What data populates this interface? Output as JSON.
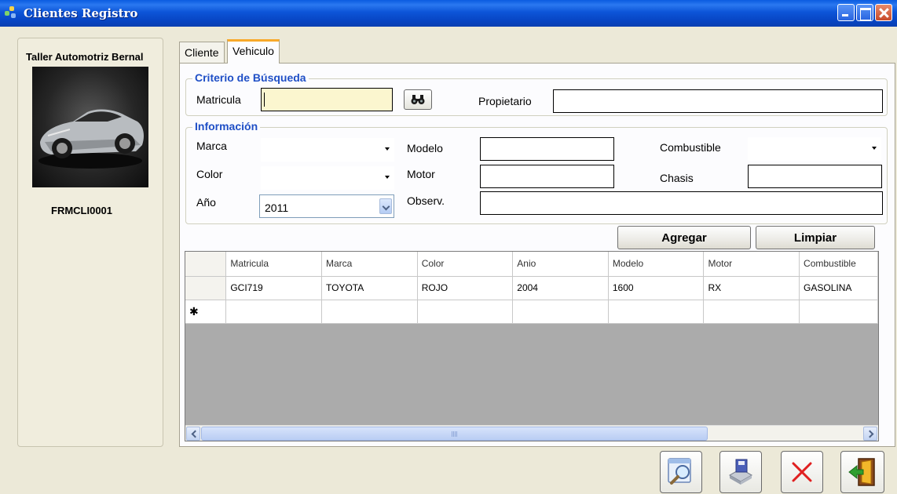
{
  "window": {
    "title": "Clientes Registro"
  },
  "left_panel": {
    "company": "Taller Automotriz Bernal",
    "form_code": "FRMCLI0001"
  },
  "tabs": [
    {
      "label": "Cliente",
      "active": false
    },
    {
      "label": "Vehiculo",
      "active": true
    }
  ],
  "search": {
    "legend": "Criterio de Búsqueda",
    "matricula_label": "Matricula",
    "matricula_value": "",
    "propietario_label": "Propietario",
    "propietario_value": ""
  },
  "info": {
    "legend": "Información",
    "marca_label": "Marca",
    "marca_value": "",
    "color_label": "Color",
    "color_value": "",
    "anio_label": "Año",
    "anio_value": "2011",
    "modelo_label": "Modelo",
    "motor_label": "Motor",
    "observ_label": "Observ.",
    "combustible_label": "Combustible",
    "chasis_label": "Chasis"
  },
  "buttons": {
    "agregar": "Agregar",
    "limpiar": "Limpiar"
  },
  "grid": {
    "columns": [
      "Matricula",
      "Marca",
      "Color",
      "Anio",
      "Modelo",
      "Motor",
      "Combustible"
    ],
    "rows": [
      [
        "GCI719",
        "TOYOTA",
        "ROJO",
        "2004",
        "1600",
        "RX",
        "GASOLINA"
      ]
    ],
    "new_row_marker": "✱"
  },
  "colors": {
    "title_bar": "#0a55d8",
    "legend_text": "#1f4fc6",
    "active_tab_accent": "#f8a92a",
    "delete_x": "#e02020"
  },
  "icons": [
    "app-icon",
    "binoculars-icon",
    "search-doc-icon",
    "save-disk-icon",
    "delete-x-icon",
    "exit-door-icon"
  ]
}
